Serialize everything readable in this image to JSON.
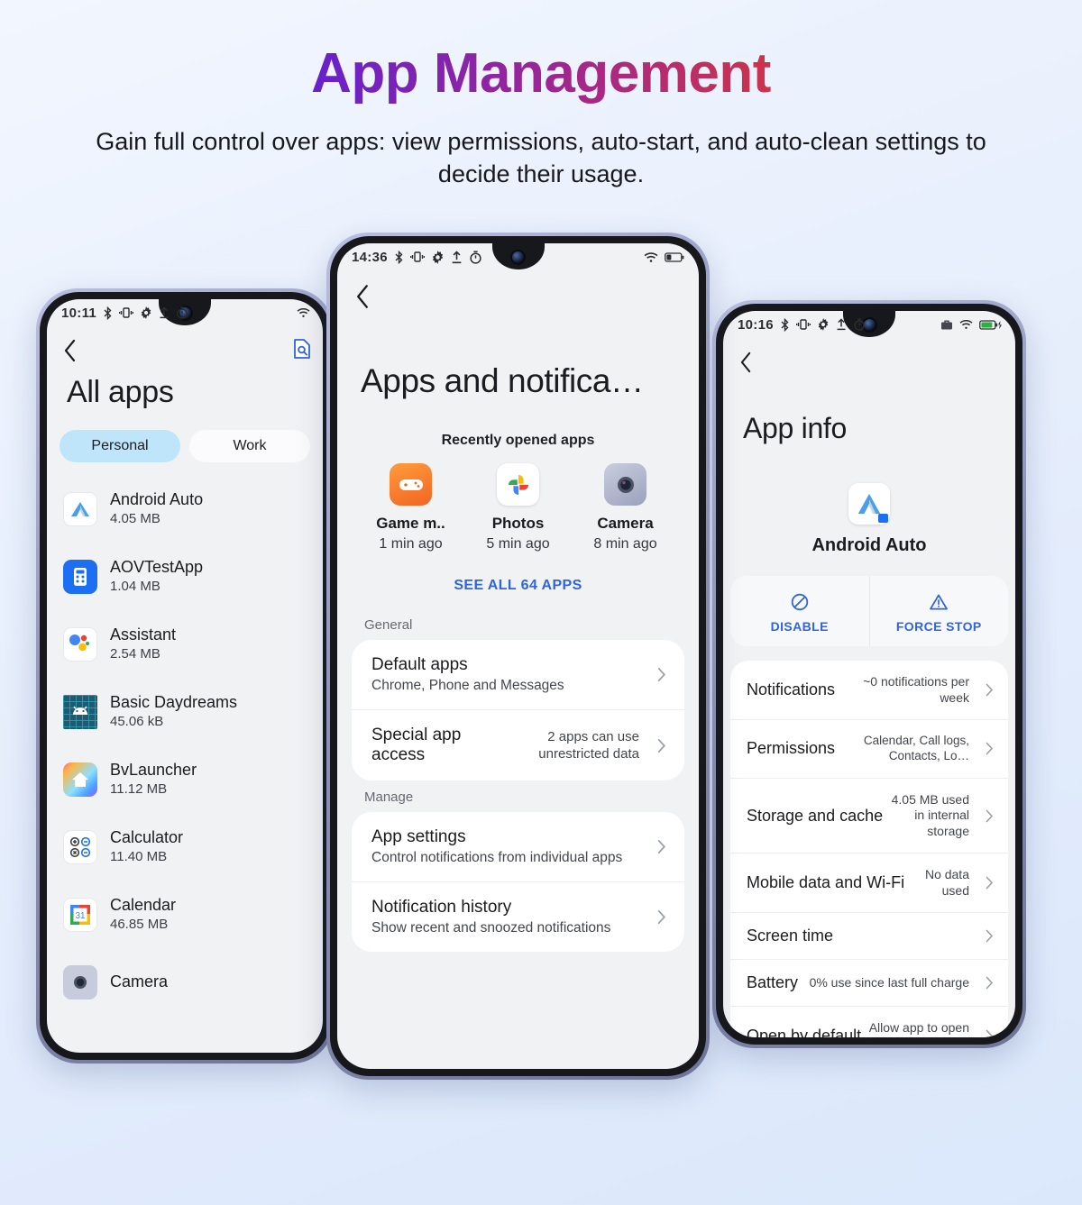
{
  "header": {
    "title": "App Management",
    "subtitle": "Gain full control over apps: view permissions, auto-start, and auto-clean settings to decide their usage."
  },
  "colors": {
    "accent_blue": "#2f64e0",
    "tab_active_bg": "#bfe5fb",
    "background_top": "#f2f6fe",
    "background_bottom": "#dbe8fb",
    "title_gradient_start": "#3b35f0",
    "title_gradient_end": "#ea4313"
  },
  "phone_left": {
    "status": {
      "time": "10:11",
      "icons": [
        "bluetooth-icon",
        "vibrate-icon",
        "gear-icon",
        "upload-icon",
        "timer-icon"
      ],
      "right_icons": [
        "wifi-icon"
      ]
    },
    "back_icon": "back-chevron-icon",
    "search_icon": "document-search-icon",
    "screen_title": "All apps",
    "tabs": [
      {
        "label": "Personal",
        "active": true
      },
      {
        "label": "Work",
        "active": false
      }
    ],
    "apps": [
      {
        "name": "Android Auto",
        "size": "4.05 MB",
        "icon": "android-auto-icon"
      },
      {
        "name": "AOVTestApp",
        "size": "1.04 MB",
        "icon": "aovtestapp-icon"
      },
      {
        "name": "Assistant",
        "size": "2.54 MB",
        "icon": "google-assistant-icon"
      },
      {
        "name": "Basic Daydreams",
        "size": "45.06 kB",
        "icon": "basic-daydreams-icon"
      },
      {
        "name": "BvLauncher",
        "size": "11.12 MB",
        "icon": "bvlauncher-icon"
      },
      {
        "name": "Calculator",
        "size": "11.40 MB",
        "icon": "calculator-icon"
      },
      {
        "name": "Calendar",
        "size": "46.85 MB",
        "icon": "calendar-icon"
      },
      {
        "name": "Camera",
        "size": "",
        "icon": "camera-icon"
      }
    ]
  },
  "phone_middle": {
    "status": {
      "time": "14:36",
      "icons": [
        "bluetooth-icon",
        "vibrate-icon",
        "gear-icon",
        "upload-icon",
        "timer-icon"
      ],
      "right_icons": [
        "wifi-icon",
        "battery-low-icon"
      ]
    },
    "back_icon": "back-chevron-icon",
    "screen_title": "Apps and notifica…",
    "recent_header": "Recently opened apps",
    "recents": [
      {
        "name": "Game m..",
        "time": "1 min ago",
        "icon": "game-mode-icon"
      },
      {
        "name": "Photos",
        "time": "5 min ago",
        "icon": "google-photos-icon"
      },
      {
        "name": "Camera",
        "time": "8 min ago",
        "icon": "camera-icon"
      }
    ],
    "see_all": "SEE ALL 64 APPS",
    "sections": [
      {
        "label": "General",
        "rows": [
          {
            "title": "Default apps",
            "subtitle": "Chrome, Phone and Messages",
            "value": ""
          },
          {
            "title": "Special app access",
            "subtitle": "",
            "value": "2 apps can use unrestricted data"
          }
        ]
      },
      {
        "label": "Manage",
        "rows": [
          {
            "title": "App settings",
            "subtitle": "Control notifications from individual apps",
            "value": ""
          },
          {
            "title": "Notification history",
            "subtitle": "Show recent and snoozed notifications",
            "value": ""
          }
        ]
      }
    ]
  },
  "phone_right": {
    "status": {
      "time": "10:16",
      "icons": [
        "bluetooth-icon",
        "vibrate-icon",
        "gear-icon",
        "upload-icon",
        "timer-icon"
      ],
      "right_icons": [
        "work-briefcase-icon",
        "wifi-icon",
        "battery-charging-icon"
      ]
    },
    "back_icon": "back-chevron-icon",
    "screen_title": "App info",
    "app": {
      "name": "Android Auto",
      "icon": "android-auto-icon"
    },
    "actions": [
      {
        "label": "DISABLE",
        "icon": "disable-circle-slash-icon"
      },
      {
        "label": "FORCE STOP",
        "icon": "warning-triangle-icon"
      }
    ],
    "rows": [
      {
        "title": "Notifications",
        "value": "~0 notifications per week"
      },
      {
        "title": "Permissions",
        "value": "Calendar, Call logs, Contacts, Lo…"
      },
      {
        "title": "Storage and cache",
        "value": "4.05 MB used in internal storage"
      },
      {
        "title": "Mobile data and Wi-Fi",
        "value": "No data used"
      },
      {
        "title": "Screen time",
        "value": ""
      },
      {
        "title": "Battery",
        "value": "0% use since last full charge"
      },
      {
        "title": "Open by default",
        "value": "Allow app to open supported links"
      }
    ]
  }
}
